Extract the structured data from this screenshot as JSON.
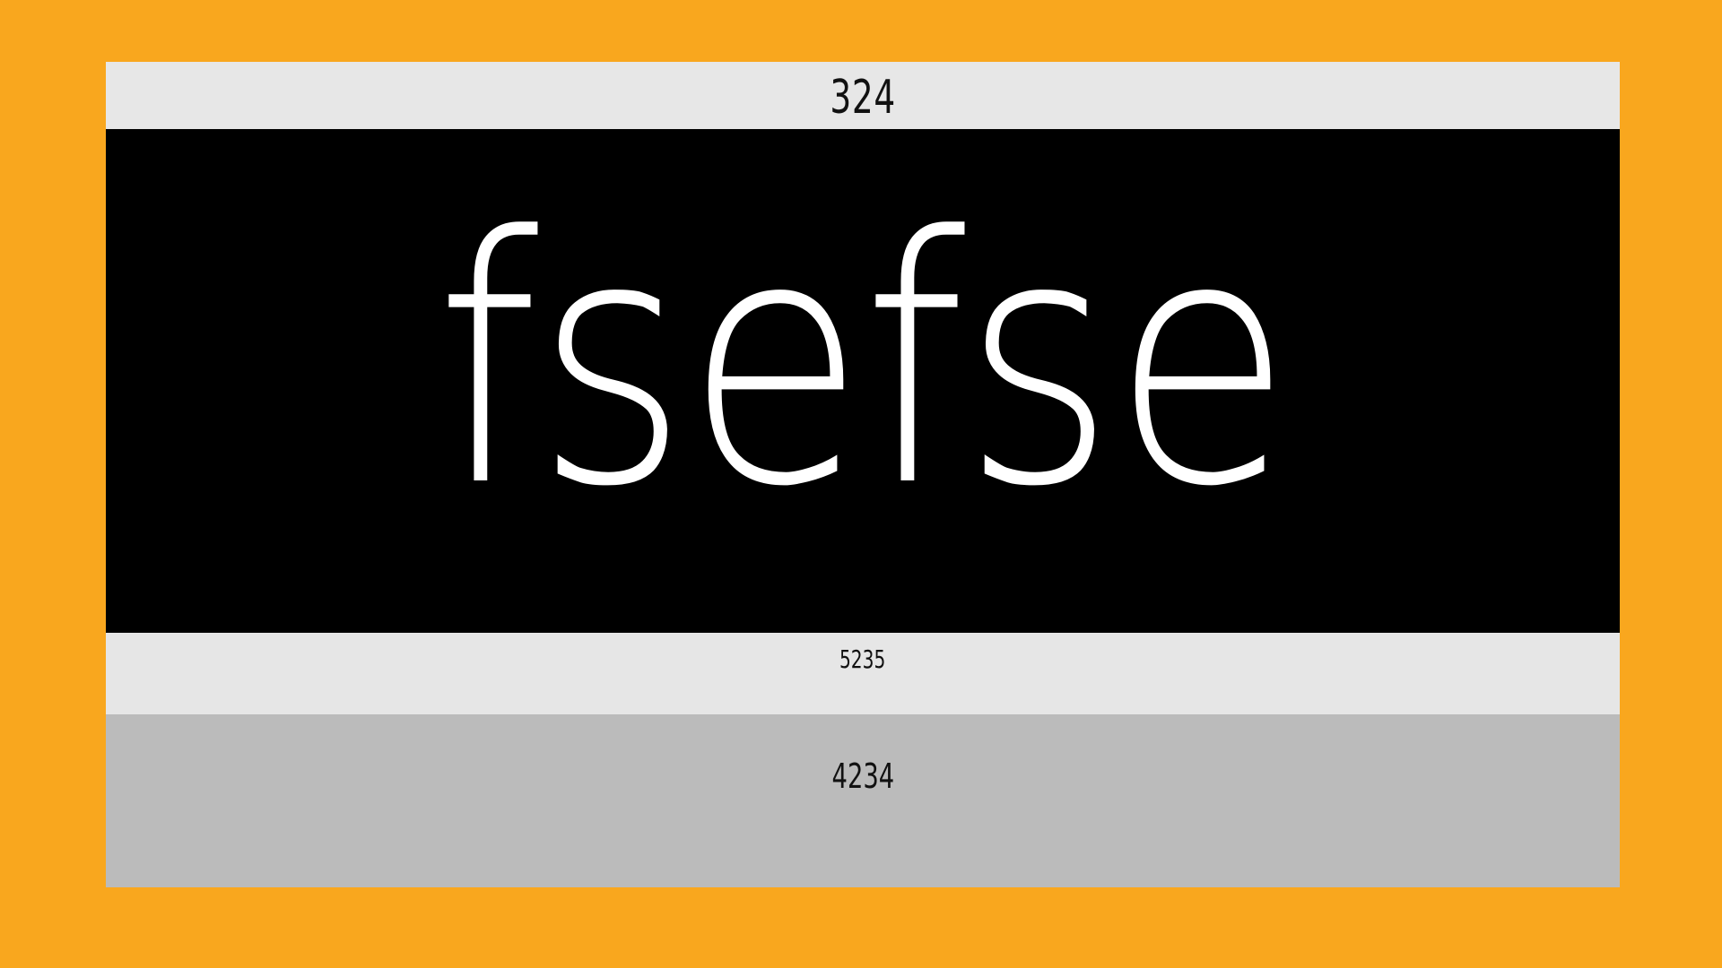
{
  "colors": {
    "frame": "#F9A71E",
    "top_band": "#E7E7E7",
    "hero_band": "#000000",
    "hero_text": "#FFFFFF",
    "mid_band": "#E6E6E6",
    "bottom_band": "#BBBBBB",
    "label_text": "#111111"
  },
  "bands": {
    "top": {
      "text": "324"
    },
    "hero": {
      "text": "fsefse"
    },
    "mid": {
      "text": "5235"
    },
    "bottom": {
      "text": "4234"
    }
  }
}
